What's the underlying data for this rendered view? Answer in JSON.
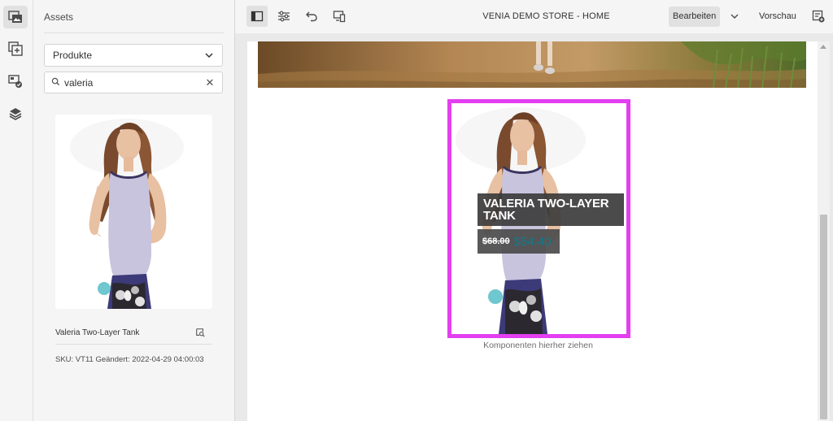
{
  "rail": {
    "items": [
      {
        "name": "assets"
      },
      {
        "name": "components"
      },
      {
        "name": "content-tree"
      },
      {
        "name": "layers"
      }
    ]
  },
  "assets_panel": {
    "title": "Assets",
    "type_select": {
      "value": "Produkte"
    },
    "search": {
      "value": "valeria",
      "placeholder": ""
    },
    "result": {
      "name": "Valeria Two-Layer Tank",
      "meta": "SKU: VT11  Geändert: 2022-04-29 04:00:03"
    }
  },
  "toolbar": {
    "page_title": "VENIA DEMO STORE - HOME",
    "edit_label": "Bearbeiten",
    "preview_label": "Vorschau"
  },
  "canvas": {
    "product": {
      "name": "VALERIA TWO-LAYER TANK",
      "old_price": "$68.00",
      "new_price": "$54.40"
    },
    "drop_hint": "Komponenten hierher ziehen"
  },
  "colors": {
    "selection_border": "#e33ff0",
    "sale_price": "#0f7b8c"
  }
}
